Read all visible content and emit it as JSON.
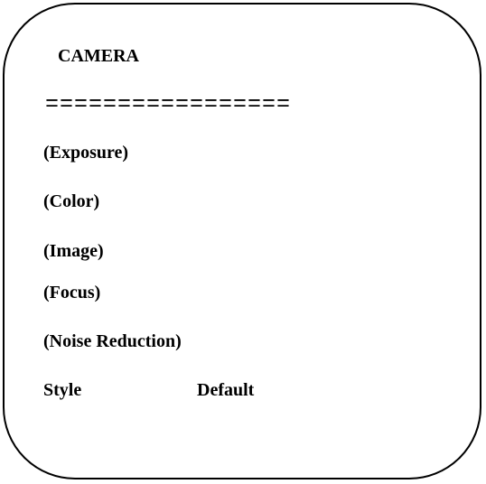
{
  "menu": {
    "title": "CAMERA",
    "separator": "=================",
    "items": [
      {
        "label": "(Exposure)"
      },
      {
        "label": "(Color)"
      },
      {
        "label": "(Image)"
      },
      {
        "label": "(Focus)"
      },
      {
        "label": "(Noise Reduction)"
      }
    ],
    "style_label": "Style",
    "style_value": "Default"
  },
  "colors": {
    "text": "#000000",
    "background": "#ffffff",
    "border": "#000000"
  }
}
